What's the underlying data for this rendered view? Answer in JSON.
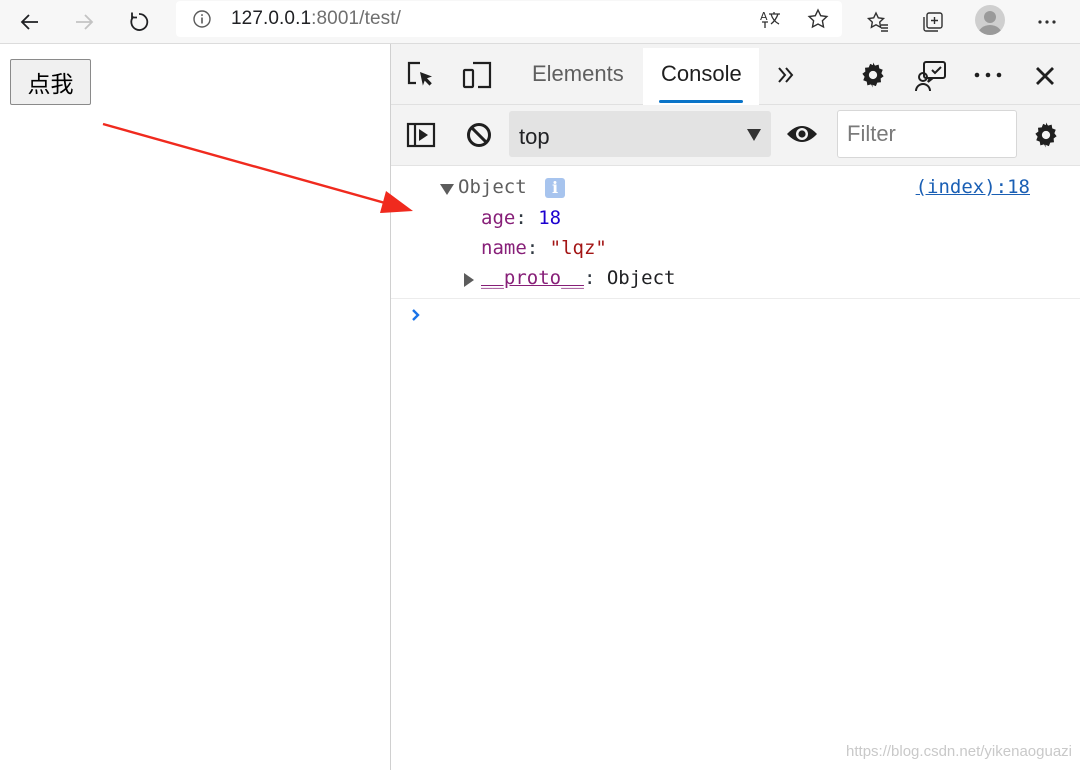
{
  "browser": {
    "url_host": "127.0.0.1",
    "url_path": ":8001/test/",
    "icons": [
      "back-arrow-icon",
      "forward-arrow-icon",
      "refresh-icon",
      "info-icon",
      "translate-icon",
      "star-icon",
      "favorites-icon",
      "collections-icon",
      "profile-icon",
      "more-icon"
    ]
  },
  "page": {
    "button_label": "点我"
  },
  "devtools": {
    "tabs": [
      {
        "label": "Elements",
        "active": false
      },
      {
        "label": "Console",
        "active": true
      }
    ],
    "toolbar_icons": [
      "inspect-icon",
      "device-toggle-icon",
      "more-tabs-icon",
      "settings-icon",
      "feedback-icon",
      "more-options-icon",
      "close-icon"
    ],
    "console_toolbar": {
      "context": "top",
      "filter_placeholder": "Filter"
    },
    "console": {
      "entry": {
        "label": "Object",
        "info_badge": "i",
        "source": "(index):18",
        "properties": [
          {
            "key": "age",
            "value": "18",
            "type": "number"
          },
          {
            "key": "name",
            "value": "\"lqz\"",
            "type": "string"
          },
          {
            "key": "__proto__",
            "value": "Object",
            "type": "object"
          }
        ]
      }
    }
  },
  "watermark": "https://blog.csdn.net/yikenaoguazi",
  "colors": {
    "accent": "#0a74c8",
    "arrow": "#f02a1e",
    "key": "#871f78",
    "number": "#1c00cf",
    "string": "#a31515"
  }
}
